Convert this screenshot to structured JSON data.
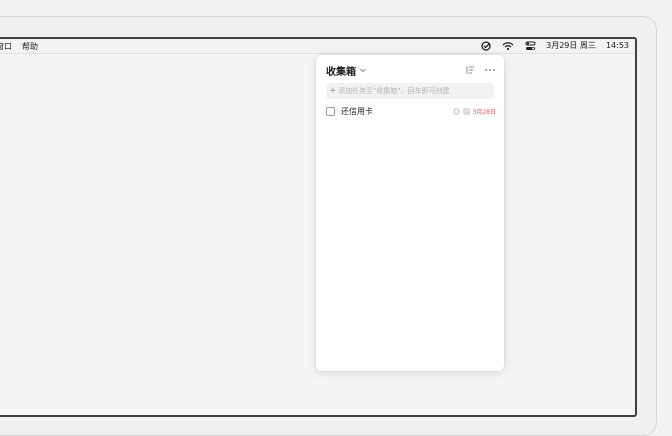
{
  "menubar": {
    "items": [
      "窗口",
      "帮助"
    ],
    "date": "3月29日 周三",
    "time": "14:53",
    "icons": [
      "ticktick-check-icon",
      "wifi-icon",
      "control-center-icon"
    ]
  },
  "popover": {
    "title": "收集箱",
    "add_placeholder": "添加任务至\"收集箱\"，回车即可创建",
    "tasks": [
      {
        "title": "还信用卡",
        "due": "3月28日"
      }
    ]
  },
  "colors": {
    "due_red": "#e0554a",
    "background": "#f2f2f4"
  }
}
